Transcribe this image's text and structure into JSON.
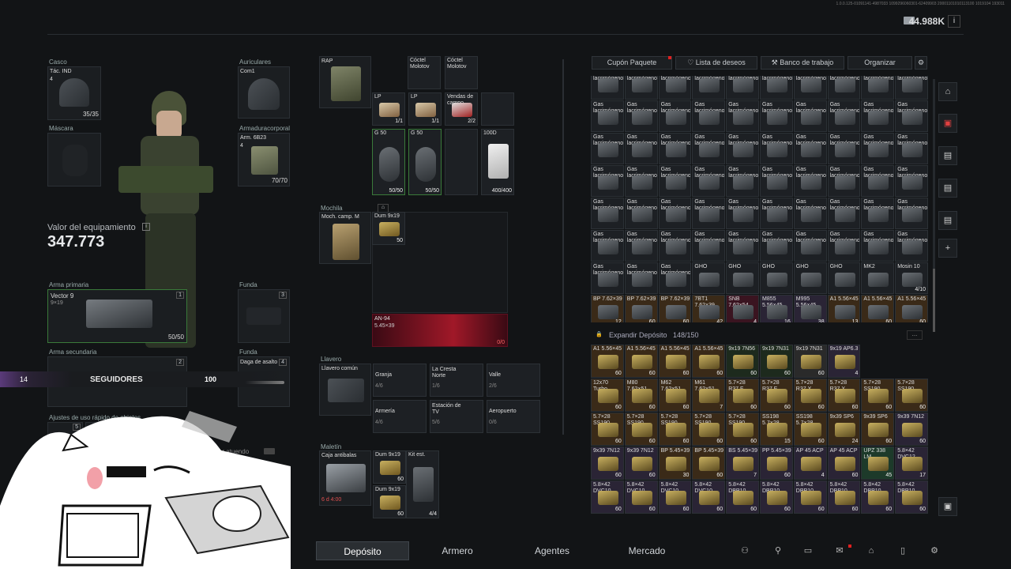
{
  "version": "1.0.0.125-01091141-4987033 1099296060301-62409903 20001101010113100 1019104 193011",
  "money": "44.988K",
  "info_btn": "i",
  "slots": {
    "helmet": {
      "label": "Casco",
      "name": "Tác. IND",
      "level": "4",
      "durability": "35/35"
    },
    "mask": {
      "label": "Máscara"
    },
    "headset": {
      "label": "Auriculares",
      "name": "Com1"
    },
    "armor": {
      "label": "Armaduracorporal",
      "name": "Arm. 6B23",
      "level": "4",
      "durability": "70/70"
    },
    "primary": {
      "label": "Arma primaria",
      "name": "Vector 9",
      "caliber": "9×19",
      "badge": "1",
      "ammo": "50/50"
    },
    "holster1": {
      "label": "Funda",
      "badge": "3"
    },
    "secondary": {
      "label": "Arma secundaria",
      "badge": "2"
    },
    "holster2": {
      "label": "Funda",
      "name": "Daga de asalto",
      "badge": "4"
    }
  },
  "value_title": "Valor del equipamiento",
  "value_number": "347.773",
  "followers": {
    "level": "14",
    "label": "SEGUIDORES",
    "count": "100"
  },
  "quickslots_label": "Ajustes de uso rápido de objetos",
  "quickslots": [
    "5",
    "6"
  ],
  "auto_label": "trar atuendo",
  "rig": {
    "label": "RAP",
    "items": [
      {
        "name": "Cóctel Molotov",
        "count": ""
      },
      {
        "name": "Cóctel Molotov",
        "count": ""
      },
      {
        "name": "LP",
        "count": "1/1"
      },
      {
        "name": "LP",
        "count": "1/1"
      },
      {
        "name": "Vendas de campo",
        "count": "2/2"
      },
      {
        "name": "G 50",
        "count": "50/50"
      },
      {
        "name": "G 50",
        "count": "50/50"
      },
      {
        "name": "100D",
        "count": "400/400"
      }
    ]
  },
  "backpack": {
    "label": "Mochila",
    "name": "Moch. camp. M",
    "item1": {
      "name": "Dum 9x19",
      "count": "50"
    },
    "item2": {
      "name": "AN-94",
      "caliber": "5.45×39",
      "count": "0/0"
    }
  },
  "keychain": {
    "label": "Llavero",
    "name": "Llavero común",
    "keys": [
      {
        "name": "Granja",
        "count": "4/6"
      },
      {
        "name": "La Cresta Norte",
        "count": "1/6"
      },
      {
        "name": "Valle",
        "count": "2/6"
      },
      {
        "name": "Armería",
        "count": "4/6"
      },
      {
        "name": "Estación de TV",
        "count": "5/6"
      },
      {
        "name": "Aeropuerto",
        "count": "0/6"
      }
    ]
  },
  "case": {
    "label": "Maletín",
    "name": "Caja antibalas",
    "timer": "6 d 4:00",
    "items": [
      {
        "name": "Dum 9x19",
        "count": "60"
      },
      {
        "name": "Kit est.",
        "count": "4/4"
      },
      {
        "name": "Dum 9x19",
        "count": "60"
      }
    ]
  },
  "toolbar": {
    "coupon": "Cupón Paquete",
    "wishlist": "Lista de deseos",
    "workbench": "Banco de trabajo",
    "organize": "Organizar"
  },
  "stash_top": {
    "gas_label": "Gas lacrimógeno",
    "rows": [
      [
        "GHO",
        "GHO",
        "GHO",
        "GHO",
        "GHO",
        "MK2",
        "Mosin 10"
      ],
      [
        "BP 7.62×39",
        "BP 7.62×39",
        "BP 7.62×39",
        "7BT1 7.62×39",
        "SNB 7.62×54",
        "M855 5.56×45",
        "M995 5.56×45",
        "A1 5.56×45",
        "A1 5.56×45",
        "A1 5.56×45"
      ]
    ],
    "counts": [
      "12",
      "60",
      "60",
      "42",
      "4",
      "16",
      "38",
      "13",
      "60",
      "60"
    ],
    "mosin_count": "4/10"
  },
  "expand": {
    "label": "Expandir Depósito",
    "capacity": "148/150",
    "more": "..."
  },
  "stash_bottom": [
    [
      {
        "n": "A1 5.56×45",
        "c": "60"
      },
      {
        "n": "A1 5.56×45",
        "c": "60"
      },
      {
        "n": "A1 5.56×45",
        "c": "60"
      },
      {
        "n": "A1 5.56×45",
        "c": "60"
      },
      {
        "n": "9x19 7N56",
        "c": "60"
      },
      {
        "n": "9x19 7N31",
        "c": "60"
      },
      {
        "n": "9x19 7N31",
        "c": "60"
      },
      {
        "n": "9x19 AP6.3",
        "c": "4"
      }
    ],
    [
      {
        "n": "12x70 Turbo",
        "c": "60"
      },
      {
        "n": "M80 7.62×51",
        "c": "60"
      },
      {
        "n": "M62 7.62×51",
        "c": "60"
      },
      {
        "n": "M61 7.62×51",
        "c": "7"
      },
      {
        "n": "5.7×28 R37.F",
        "c": "60"
      },
      {
        "n": "5.7×28 R37.F",
        "c": "60"
      },
      {
        "n": "5.7×28 R37.X",
        "c": "60"
      },
      {
        "n": "5.7×28 R37.X",
        "c": "60"
      },
      {
        "n": "5.7×28 SS190",
        "c": "60"
      },
      {
        "n": "5.7×28 SS190",
        "c": "60"
      }
    ],
    [
      {
        "n": "5.7×28 SS190",
        "c": "60"
      },
      {
        "n": "5.7×28 SS190",
        "c": "60"
      },
      {
        "n": "5.7×28 SS190",
        "c": "60"
      },
      {
        "n": "5.7×28 SS190",
        "c": "60"
      },
      {
        "n": "5.7×28 SS190",
        "c": "60"
      },
      {
        "n": "SS198 5.7×28",
        "c": "15"
      },
      {
        "n": "SS198 5.7×28",
        "c": "60"
      },
      {
        "n": "9x39 SP6",
        "c": "24"
      },
      {
        "n": "9x39 SP6",
        "c": "60"
      },
      {
        "n": "9x39 7N12",
        "c": "60"
      }
    ],
    [
      {
        "n": "9x39 7N12",
        "c": "60"
      },
      {
        "n": "9x39 7N12",
        "c": "60"
      },
      {
        "n": "BP 5.45×39",
        "c": "30"
      },
      {
        "n": "BP 5.45×39",
        "c": "60"
      },
      {
        "n": "BS 5.45×39",
        "c": "7"
      },
      {
        "n": "PP 5.45×39",
        "c": "60"
      },
      {
        "n": "AP 45 ACP",
        "c": "4"
      },
      {
        "n": "AP 45 ACP",
        "c": "60"
      },
      {
        "n": "UPZ 338 LM",
        "c": "45"
      },
      {
        "n": "5.8×42 DVC12",
        "c": "17"
      }
    ],
    [
      {
        "n": "5.8×42 DVC10",
        "c": "60"
      },
      {
        "n": "5.8×42 DVC10",
        "c": "60"
      },
      {
        "n": "5.8×42 DVC10",
        "c": "60"
      },
      {
        "n": "5.8×42 DVC10",
        "c": "60"
      },
      {
        "n": "5.8×42 DBP10",
        "c": "60"
      },
      {
        "n": "5.8×42 DBP10",
        "c": "60"
      },
      {
        "n": "5.8×42 DBP10",
        "c": "60"
      },
      {
        "n": "5.8×42 DBP10",
        "c": "60"
      },
      {
        "n": "5.8×42 DBP10",
        "c": "60"
      },
      {
        "n": "5.8×42 DBP10",
        "c": "60"
      }
    ]
  ],
  "nav": {
    "stash": "Depósito",
    "armory": "Armero",
    "agents": "Agentes",
    "market": "Mercado"
  },
  "colors": {
    "accent_purple": "#6b3fa0",
    "green_border": "#3a7a3a",
    "red_item": "#b01830"
  }
}
